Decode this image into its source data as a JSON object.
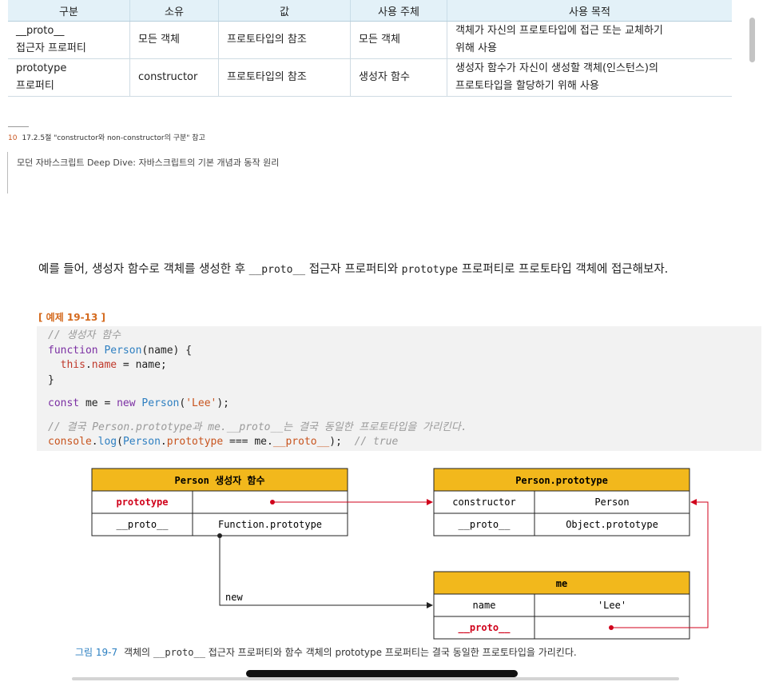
{
  "table": {
    "headers": [
      "구분",
      "소유",
      "값",
      "사용 주체",
      "사용 목적"
    ],
    "rows": [
      [
        "__proto__\n접근자 프로퍼티",
        "모든 객체",
        "프로토타입의 참조",
        "모든 객체",
        "객체가 자신의 프로토타입에 접근 또는 교체하기\n위해 사용"
      ],
      [
        "prototype\n프로퍼티",
        "constructor",
        "프로토타입의 참조",
        "생성자 함수",
        "생성자 함수가 자신이 생성할 객체(인스턴스)의\n프로토타입을 할당하기 위해 사용"
      ]
    ]
  },
  "footnote": {
    "number": "10",
    "text": "17.2.5절 \"constructor와 non-constructor의 구분\" 참고"
  },
  "running_title": "모던 자바스크립트 Deep Dive: 자바스크립트의 기본 개념과 동작 원리",
  "body": {
    "part1": "예를 들어, 생성자 함수로 객체를 생성한 후 ",
    "code1": "__proto__",
    "part2": " 접근자 프로퍼티와 ",
    "code2": "prototype",
    "part3": " 프로퍼티로 프로토타입 객체에 접근해보자."
  },
  "example_title": "[ 예제 19-13 ]",
  "code": {
    "comment1": "// 생성자 함수",
    "kw_function": "function",
    "fn_person": "Person",
    "sig_rest": "(name) {",
    "kw_this": "this",
    "dot": ".",
    "pr_name": "name",
    "assign_rest": " = name;",
    "close_brace": "}",
    "kw_const": "const",
    "var_me": " me = ",
    "kw_new": "new",
    "sp": " ",
    "call_open": "(",
    "str_lee": "'Lee'",
    "call_close": ");",
    "comment2": "// 결국 Person.prototype과 me.__proto__는 결국 동일한 프로토타입을 가리킨다.",
    "console": "console",
    "log": "log",
    "pr_prototype": "prototype",
    "eq": " === me.",
    "pr_proto": "__proto__",
    "end": ");",
    "comment3": "  // true"
  },
  "diagram": {
    "person_ctor": {
      "title": "Person 생성자 함수",
      "row1_key": "prototype",
      "row2_key": "__proto__",
      "row2_val": "Function.prototype"
    },
    "person_proto": {
      "title": "Person.prototype",
      "row1_key": "constructor",
      "row1_val": "Person",
      "row2_key": "__proto__",
      "row2_val": "Object.prototype"
    },
    "me": {
      "title": "me",
      "row1_key": "name",
      "row1_val": "'Lee'",
      "row2_key": "__proto__"
    },
    "edge_label": "new",
    "colors": {
      "header": "#f2b81c",
      "red": "#d0021b",
      "line": "#222222"
    }
  },
  "caption": {
    "figure": "그림 19-7",
    "part1": " 객체의 ",
    "code1": "__proto__",
    "part2": " 접근자 프로퍼티와 함수 객체의 prototype 프로퍼티는 결국 동일한 프로토타입을 가리킨다."
  }
}
